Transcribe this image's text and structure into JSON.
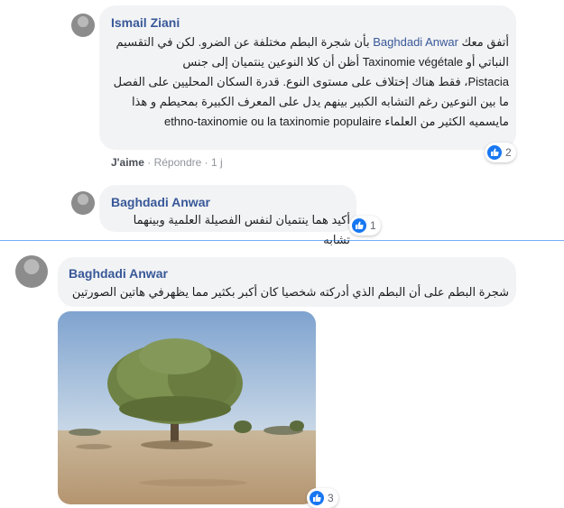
{
  "comments": [
    {
      "author": "Ismail Ziani",
      "lines": [
        {
          "pre": "أتفق معك ",
          "mention": "Baghdadi Anwar",
          "post": " بأن شجرة البطم مختلفة عن الضرو. لكن في التقسيم"
        },
        {
          "pre": "النباتي أو ",
          "mention": "Taxinomie végétale",
          "post": " أظن أن كلا النوعين ينتميان إلى جنس"
        },
        {
          "pre": "Pistacia",
          "mention": "",
          "post": "، فقط هناك إختلاف على مستوى النوع. قدرة السكان المحليين على الفصل"
        },
        {
          "pre": "ما بين النوعين رغم التشابه الكبير بينهم يدل على المعرف الكبيرة بمحيطم و هذا",
          "mention": "",
          "post": ""
        },
        {
          "pre": "مايسميه الكثير من العلماء ",
          "mention": "ethno-taxinomie ou la taxinomie populaire",
          "post": ""
        }
      ],
      "reaction_count": "2",
      "actions": {
        "like": "J'aime",
        "reply": "Répondre",
        "time": "1 j"
      }
    },
    {
      "author": "Baghdadi Anwar",
      "text": "أكيد هما ينتميان لنفس الفصيلة العلمية وبينهما تشابه",
      "reaction_count": "1"
    },
    {
      "author": "Baghdadi Anwar",
      "text": "شجرة البطم على أن البطم الذي أدركته شخصيا كان أكبر بكثير مما يظهرفي هاتين الصورتين",
      "reaction_count": "3"
    }
  ],
  "colors": {
    "link": "#385898",
    "bubble": "#f2f3f5",
    "like_blue": "#1877f2"
  }
}
